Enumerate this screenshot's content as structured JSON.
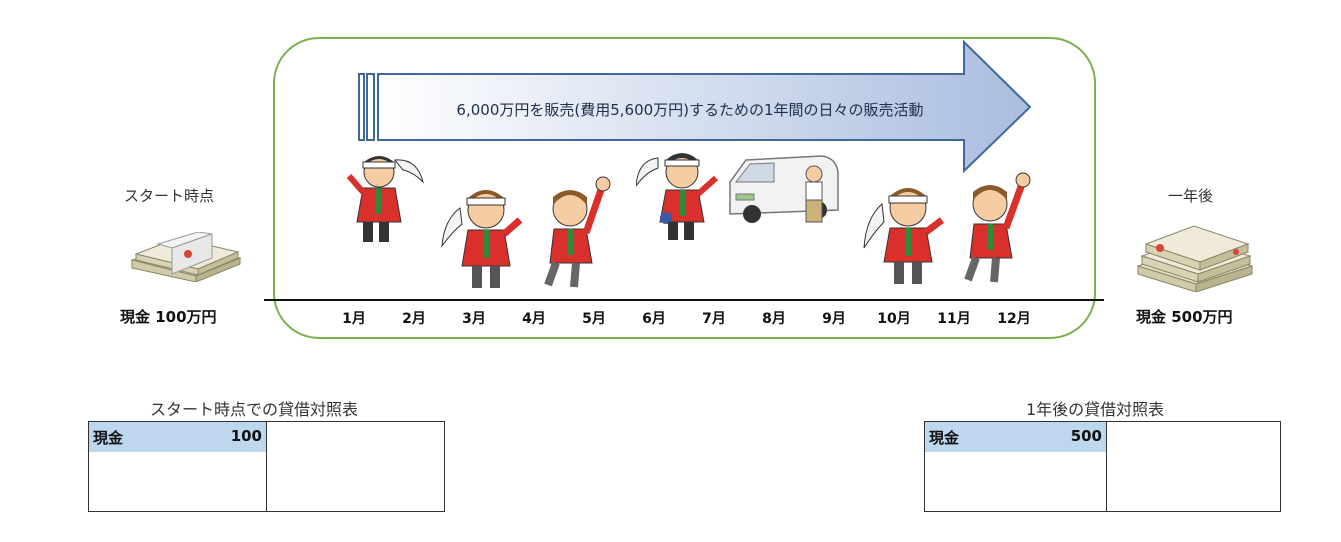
{
  "left": {
    "caption": "スタート時点",
    "cash_label": "現金 100万円"
  },
  "right": {
    "caption": "一年後",
    "cash_label": "現金 500万円"
  },
  "arrow": {
    "text": "6,000万円を販売(費用5,600万円)するための1年間の日々の販売活動",
    "fill_start": "#ffffff",
    "fill_end": "#a9bddf",
    "stroke": "#41689c"
  },
  "frame_color": "#7bb04d",
  "months": [
    "1月",
    "2月",
    "3月",
    "4月",
    "5月",
    "6月",
    "7月",
    "8月",
    "9月",
    "10月",
    "11月",
    "12月"
  ],
  "bs_start": {
    "title": "スタート時点での貸借対照表",
    "item_label": "現金",
    "item_value": "100"
  },
  "bs_end": {
    "title": "1年後の貸借対照表",
    "item_label": "現金",
    "item_value": "500"
  },
  "icons": [
    "money-bundle-icon",
    "salesman-icon",
    "delivery-van-icon",
    "money-stack-icon"
  ]
}
